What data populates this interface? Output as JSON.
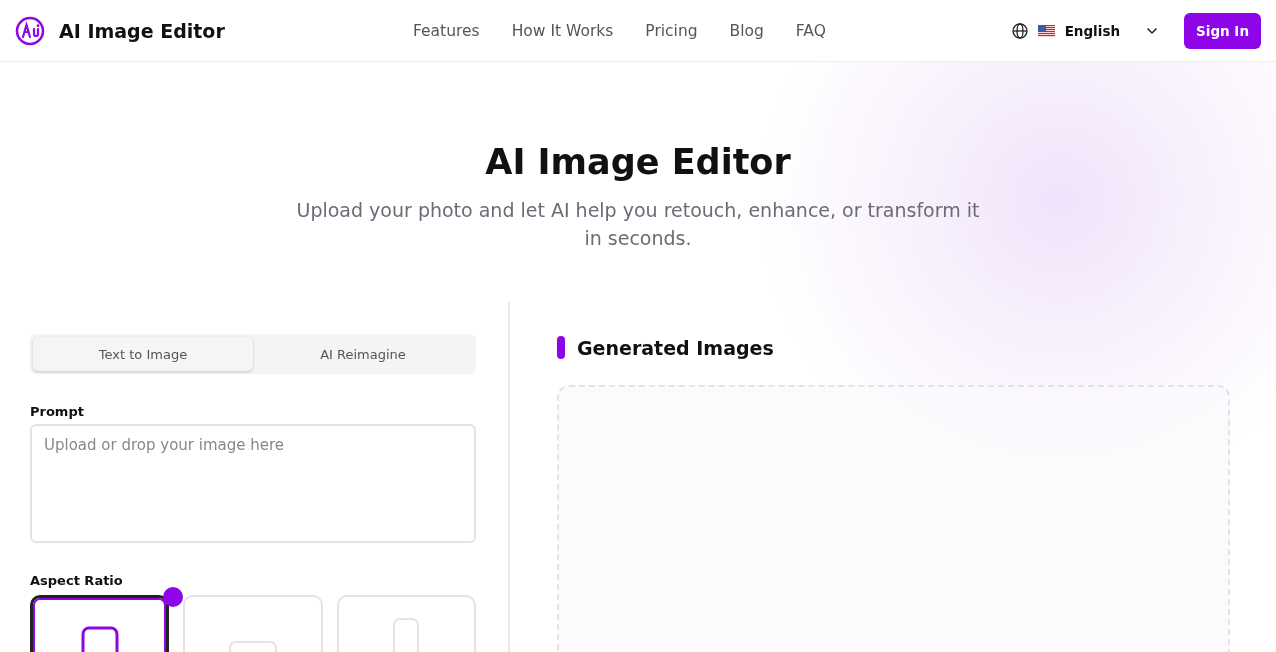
{
  "header": {
    "brand": "AI Image Editor",
    "nav": [
      {
        "label": "Features"
      },
      {
        "label": "How It Works"
      },
      {
        "label": "Pricing"
      },
      {
        "label": "Blog"
      },
      {
        "label": "FAQ"
      }
    ],
    "language": "English",
    "sign_in": "Sign In"
  },
  "hero": {
    "title": "AI Image Editor",
    "subtitle": "Upload your photo and let AI help you retouch, enhance, or transform it in seconds."
  },
  "editor": {
    "tabs": [
      {
        "label": "Text to Image",
        "selected": true
      },
      {
        "label": "AI Reimagine",
        "selected": false
      }
    ],
    "prompt": {
      "label": "Prompt",
      "placeholder": "Upload or drop your image here"
    },
    "aspect_ratio": {
      "label": "Aspect Ratio",
      "options": [
        {
          "kind": "square",
          "selected": true
        },
        {
          "kind": "landscape",
          "selected": false
        },
        {
          "kind": "portrait",
          "selected": false
        }
      ]
    }
  },
  "results": {
    "title": "Generated Images"
  }
}
